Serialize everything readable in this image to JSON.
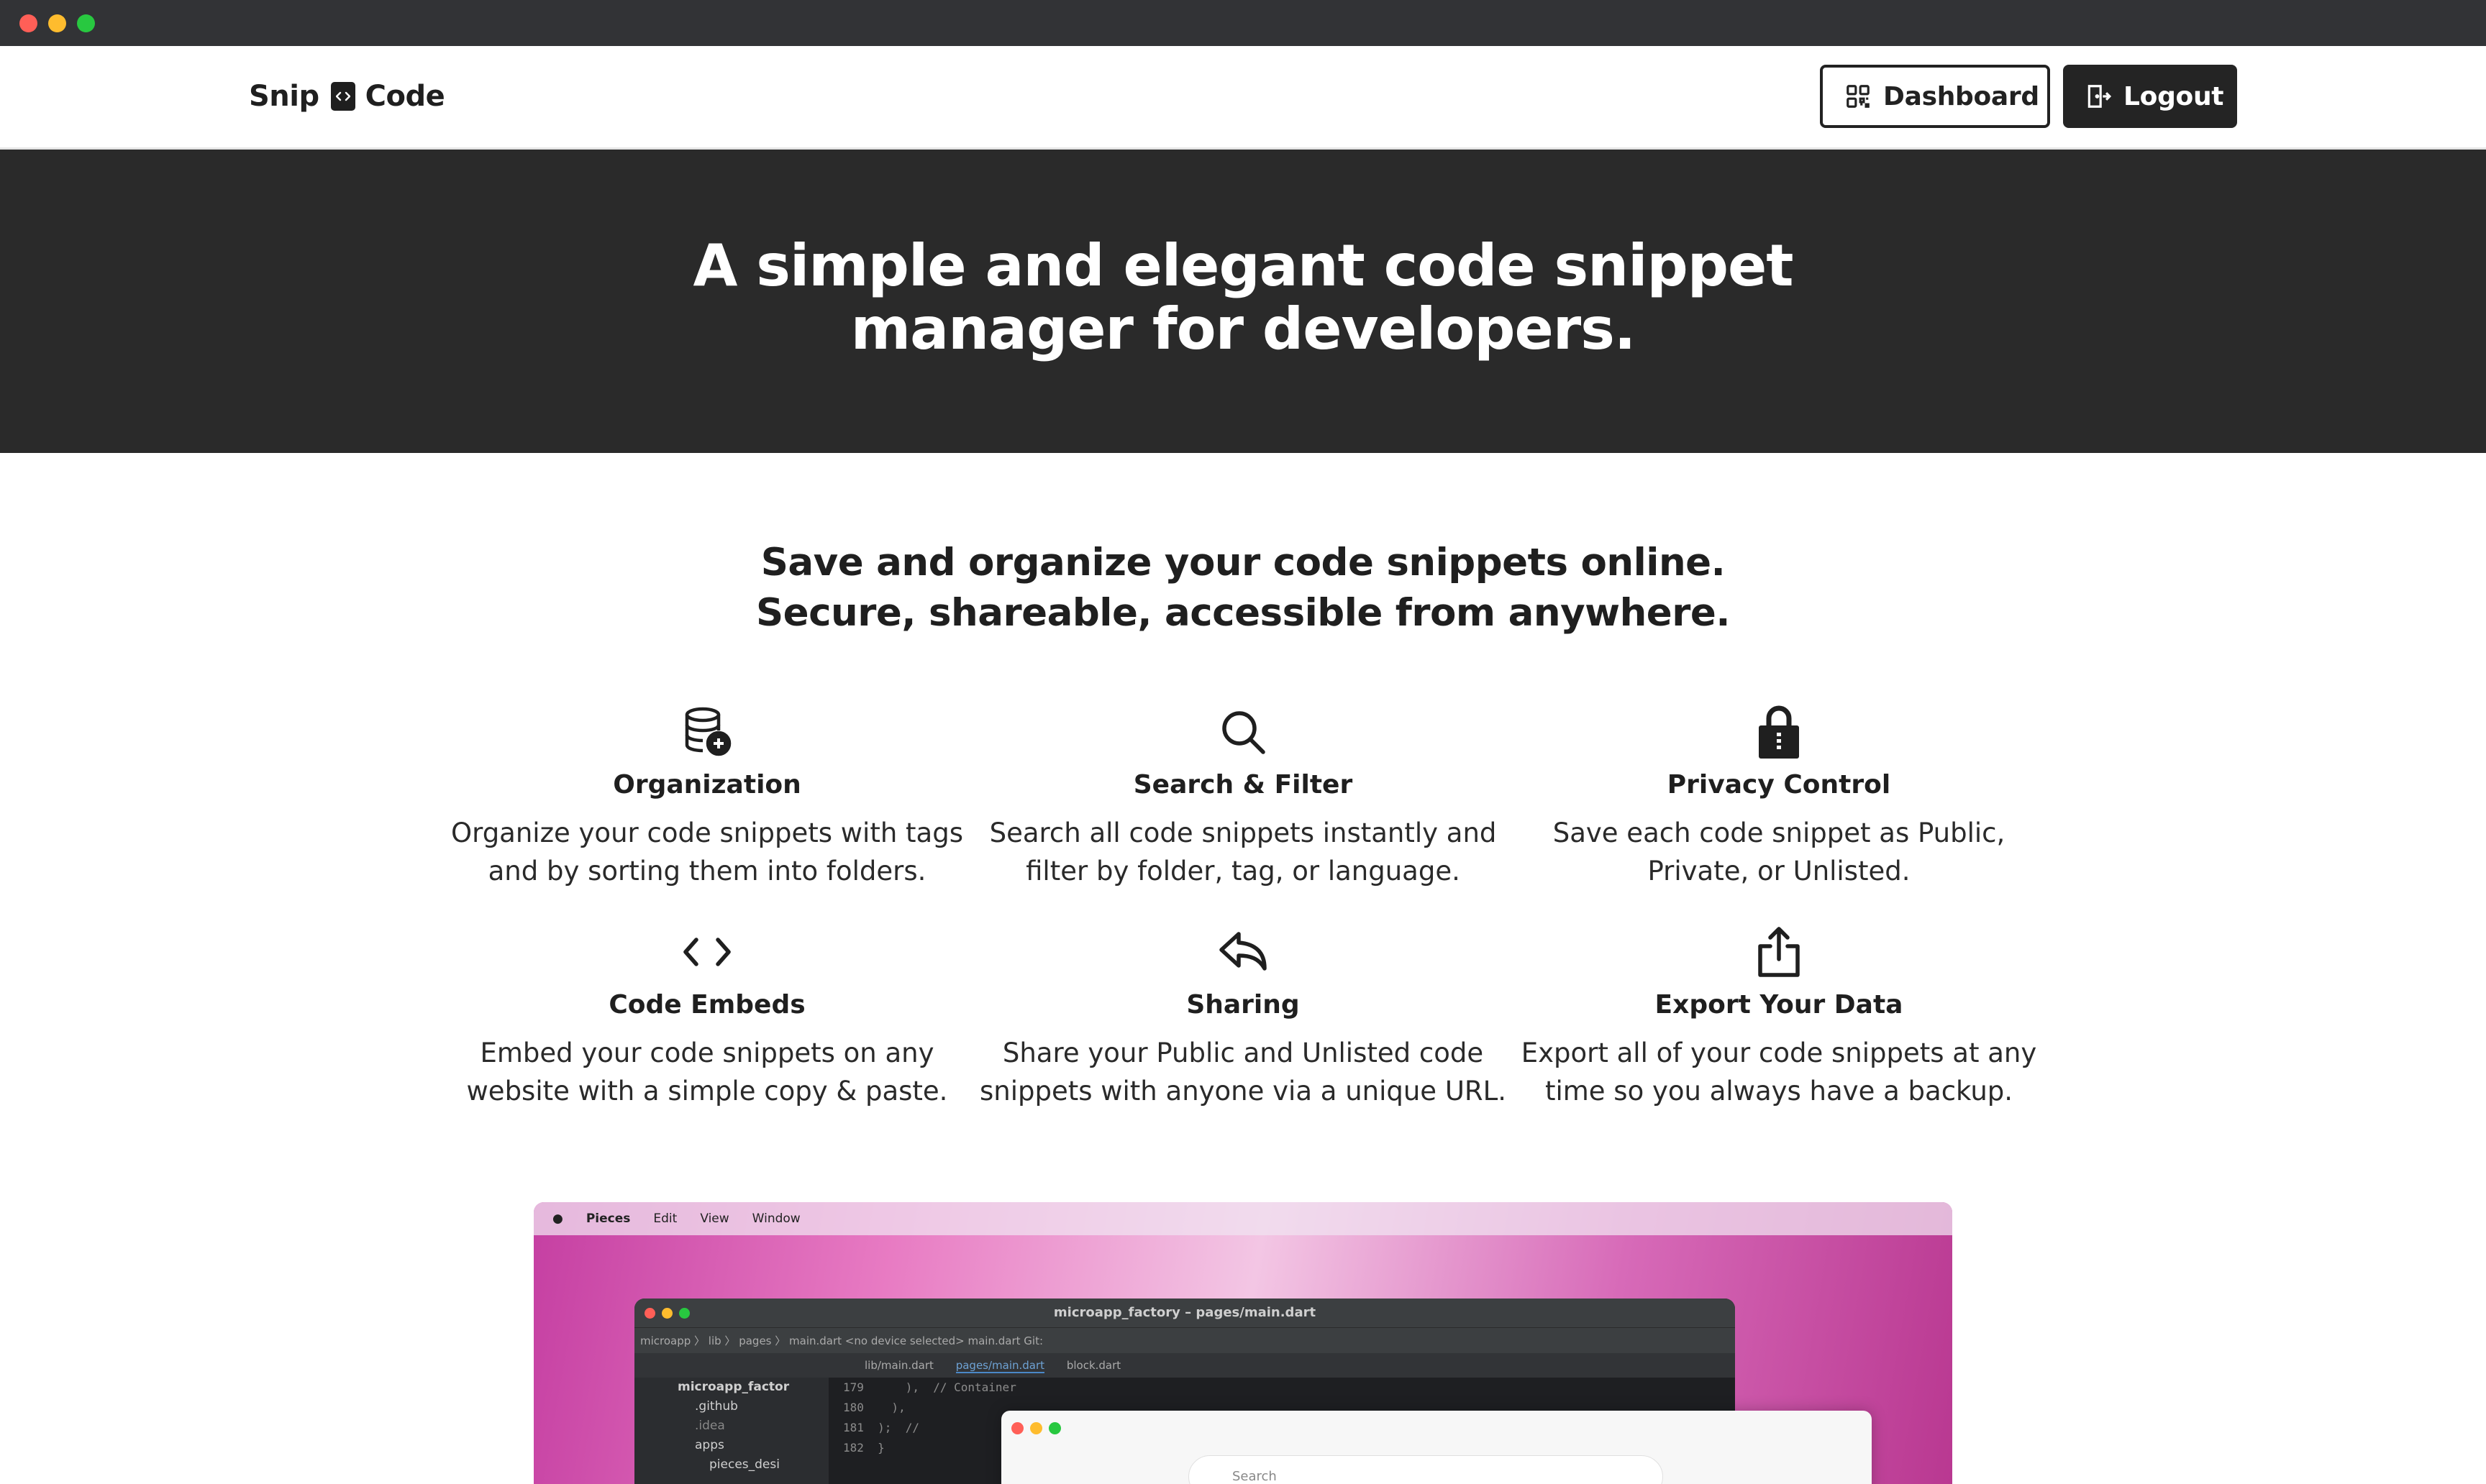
{
  "nav": {
    "brand_left": "Snip",
    "brand_right": "Code",
    "dashboard_label": "Dashboard",
    "logout_label": "Logout"
  },
  "hero": {
    "title_line1": "A simple and elegant code snippet",
    "title_line2": "manager for developers."
  },
  "intro": {
    "line1": "Save and organize your code snippets online.",
    "line2": "Secure, shareable, accessible from anywhere."
  },
  "features": [
    {
      "icon": "database-add-icon",
      "title": "Organization",
      "line1": "Organize your code snippets with tags",
      "line2": "and by sorting them into folders."
    },
    {
      "icon": "search-icon",
      "title": "Search & Filter",
      "line1": "Search all code snippets instantly and",
      "line2": "filter by folder, tag, or language."
    },
    {
      "icon": "lock-icon",
      "title": "Privacy Control",
      "line1": "Save each code snippet as Public,",
      "line2": "Private, or Unlisted."
    },
    {
      "icon": "code-icon",
      "title": "Code Embeds",
      "line1": "Embed your code snippets on any",
      "line2": "website with a simple copy & paste."
    },
    {
      "icon": "reply-icon",
      "title": "Sharing",
      "line1": "Share your Public and Unlisted code",
      "line2": "snippets with anyone via a unique URL."
    },
    {
      "icon": "share-upload-icon",
      "title": "Export Your Data",
      "line1": "Export all of your code snippets at any",
      "line2": "time so you always have a backup."
    }
  ],
  "preview": {
    "menubar": [
      "Pieces",
      "Edit",
      "View",
      "Window"
    ],
    "ide_title": "microapp_factory – pages/main.dart",
    "ide_toolbar": "microapp 〉 lib 〉 pages 〉 main.dart      <no device selected>      main.dart      Git:",
    "ide_tabs": [
      "lib/main.dart",
      "pages/main.dart",
      "block.dart"
    ],
    "tree": [
      "microapp_factor",
      ".github",
      ".idea",
      "apps",
      "pieces_desi"
    ],
    "code": "179      ),  // Container\n180    ),\n181  );  //\n182  }",
    "search_placeholder": "Search"
  },
  "colors": {
    "hero_bg": "#2a2a2a",
    "dark_button": "#242424",
    "titlebar": "#323336"
  }
}
